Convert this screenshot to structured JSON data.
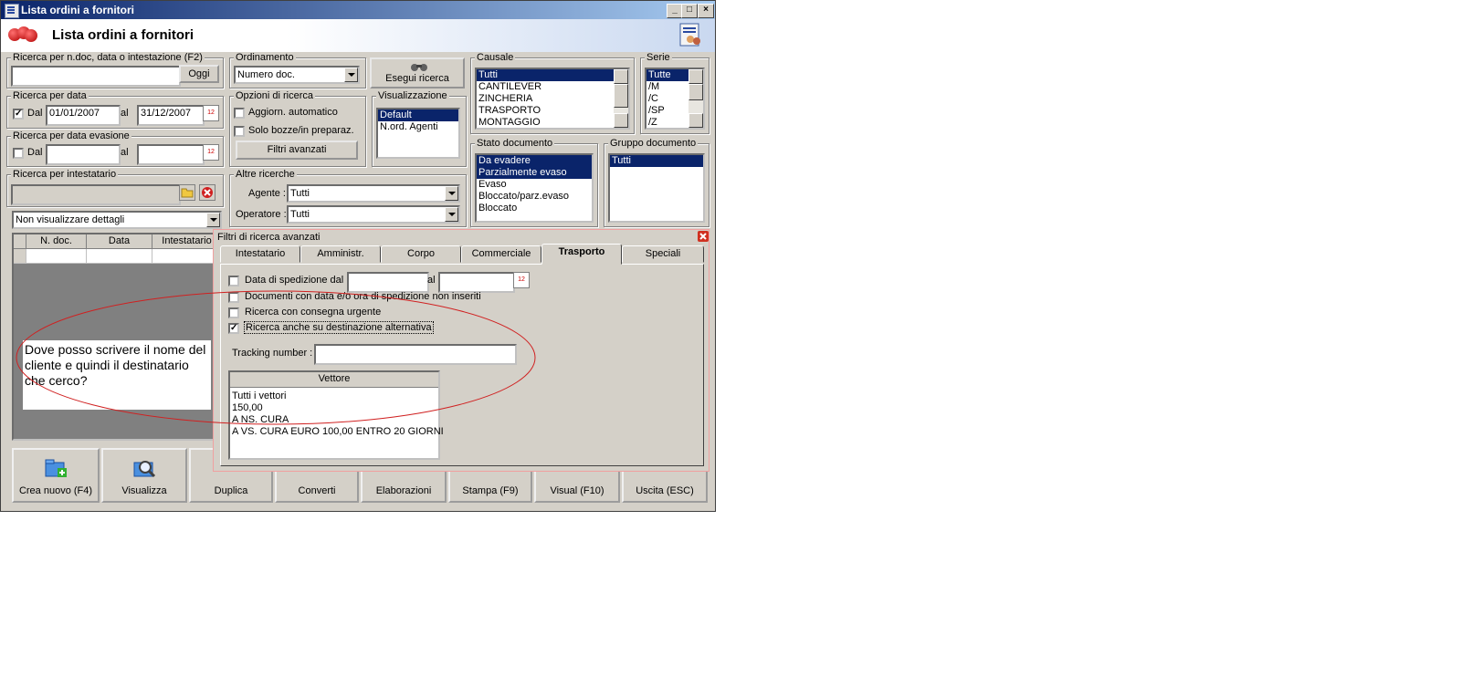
{
  "window": {
    "title": "Lista ordini a fornitori",
    "header": "Lista ordini a fornitori"
  },
  "search_doc": {
    "legend": "Ricerca per n.doc, data o intestazione (F2)",
    "value": "",
    "today_btn": "Oggi"
  },
  "ordinamento": {
    "legend": "Ordinamento",
    "selected": "Numero doc."
  },
  "esegui_btn": "Esegui ricerca",
  "causale": {
    "legend": "Causale",
    "items": [
      "Tutti",
      "CANTILEVER",
      "ZINCHERIA",
      "TRASPORTO",
      "MONTAGGIO"
    ]
  },
  "serie": {
    "legend": "Serie",
    "items": [
      "Tutte",
      "/M",
      "/C",
      "/SP",
      "/Z"
    ]
  },
  "search_date": {
    "legend": "Ricerca per data",
    "dal_label": "Dal",
    "from": "01/01/2007",
    "al_label": "al",
    "to": "31/12/2007"
  },
  "search_evasion": {
    "legend": "Ricerca per data evasione",
    "dal_label": "Dal",
    "al_label": "al"
  },
  "options": {
    "legend": "Opzioni di ricerca",
    "auto_update": "Aggiorn. automatico",
    "drafts_only": "Solo bozze/in preparaz.",
    "advanced_btn": "Filtri avanzati"
  },
  "visualizzazione": {
    "legend": "Visualizzazione",
    "items": [
      "Default",
      "N.ord. Agenti"
    ]
  },
  "stato": {
    "legend": "Stato documento",
    "items": [
      "Da evadere",
      "Parzialmente evaso",
      "Evaso",
      "Bloccato/parz.evaso",
      "Bloccato"
    ]
  },
  "gruppo": {
    "legend": "Gruppo documento",
    "items": [
      "Tutti"
    ]
  },
  "intestatario": {
    "legend": "Ricerca per intestatario"
  },
  "altre": {
    "legend": "Altre ricerche",
    "agente_label": "Agente :",
    "agente": "Tutti",
    "operatore_label": "Operatore :",
    "operatore": "Tutti"
  },
  "details_combo": "Non visualizzare dettagli",
  "grid": {
    "columns": [
      "N. doc.",
      "Data",
      "Intestatario"
    ]
  },
  "toolbar": [
    "Crea nuovo (F4)",
    "Visualizza",
    "Duplica",
    "Converti",
    "Elaborazioni",
    "Stampa (F9)",
    "Visual (F10)",
    "Uscita (ESC)"
  ],
  "advanced": {
    "title": "Filtri di ricerca avanzati",
    "tabs": [
      "Intestatario",
      "Amministr.",
      "Corpo",
      "Commerciale",
      "Trasporto",
      "Speciali"
    ],
    "active_tab": "Trasporto",
    "ship_date_label": "Data di spedizione dal",
    "al_label": "al",
    "no_ship_date": "Documenti con data e/o ora di spedizione non inseriti",
    "urgent": "Ricerca con consegna urgente",
    "alt_dest": "Ricerca anche su destinazione alternativa",
    "tracking_label": "Tracking number :",
    "tracking_value": "",
    "vettore_header": "Vettore",
    "vettori": [
      "Tutti i vettori",
      "150,00",
      "A NS. CURA",
      "A VS. CURA EURO 100,00 ENTRO 20 GIORNI"
    ]
  },
  "note": "Dove posso scrivere il nome del cliente e quindi il destinatario che cerco?"
}
